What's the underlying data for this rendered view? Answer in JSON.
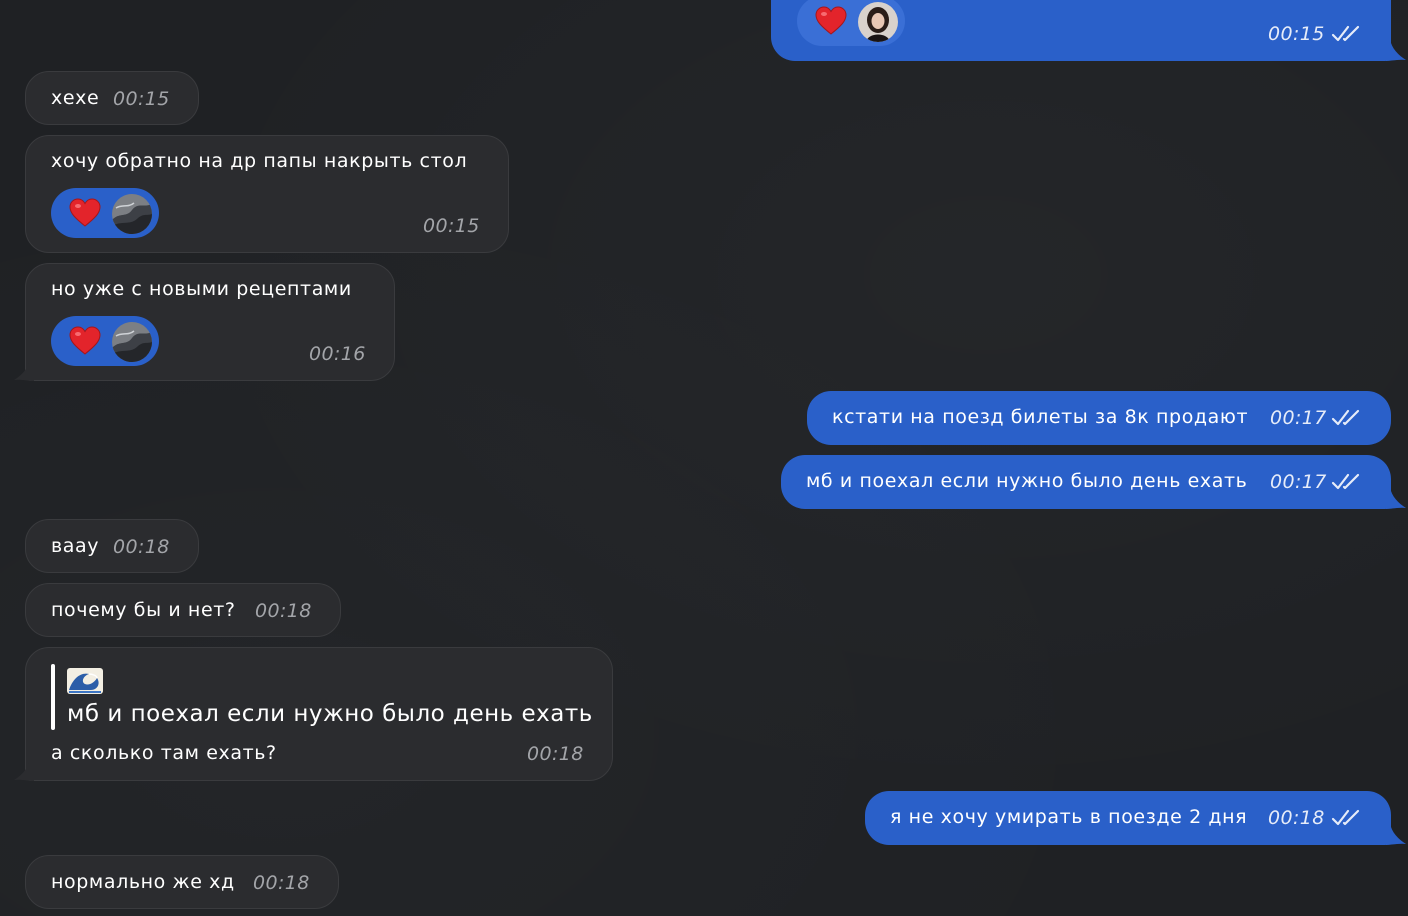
{
  "messages": {
    "m0": {
      "time": "00:15"
    },
    "m1": {
      "text": "хехе",
      "time": "00:15"
    },
    "m2": {
      "text": "хочу обратно на др папы накрыть стол",
      "time": "00:15"
    },
    "m3": {
      "text": "но уже с новыми рецептами",
      "time": "00:16"
    },
    "m4": {
      "text": "кстати на поезд билеты за 8к продают",
      "time": "00:17"
    },
    "m5": {
      "text": "мб и поехал если нужно было день ехать",
      "time": "00:17"
    },
    "m6": {
      "text": "вааy",
      "time": "00:18"
    },
    "m7": {
      "text": "почему бы и нет?",
      "time": "00:18"
    },
    "m8": {
      "reply_quote": "мб и поехал если нужно было день ехать",
      "text": "а сколько там ехать?",
      "time": "00:18"
    },
    "m9": {
      "text": "я не хочу умирать в поезде 2 дня",
      "time": "00:18"
    },
    "m10": {
      "text": "нормально же хд",
      "time": "00:18"
    }
  },
  "reaction": {
    "emoji": "heart-emoji",
    "color": "#2a60c9"
  },
  "colors": {
    "background": "#1f2124",
    "incoming_bubble": "#2b2c2f",
    "outgoing_bubble": "#2a60c9",
    "time_incoming": "#a3a5a9",
    "time_outgoing": "#e6ecf9"
  }
}
